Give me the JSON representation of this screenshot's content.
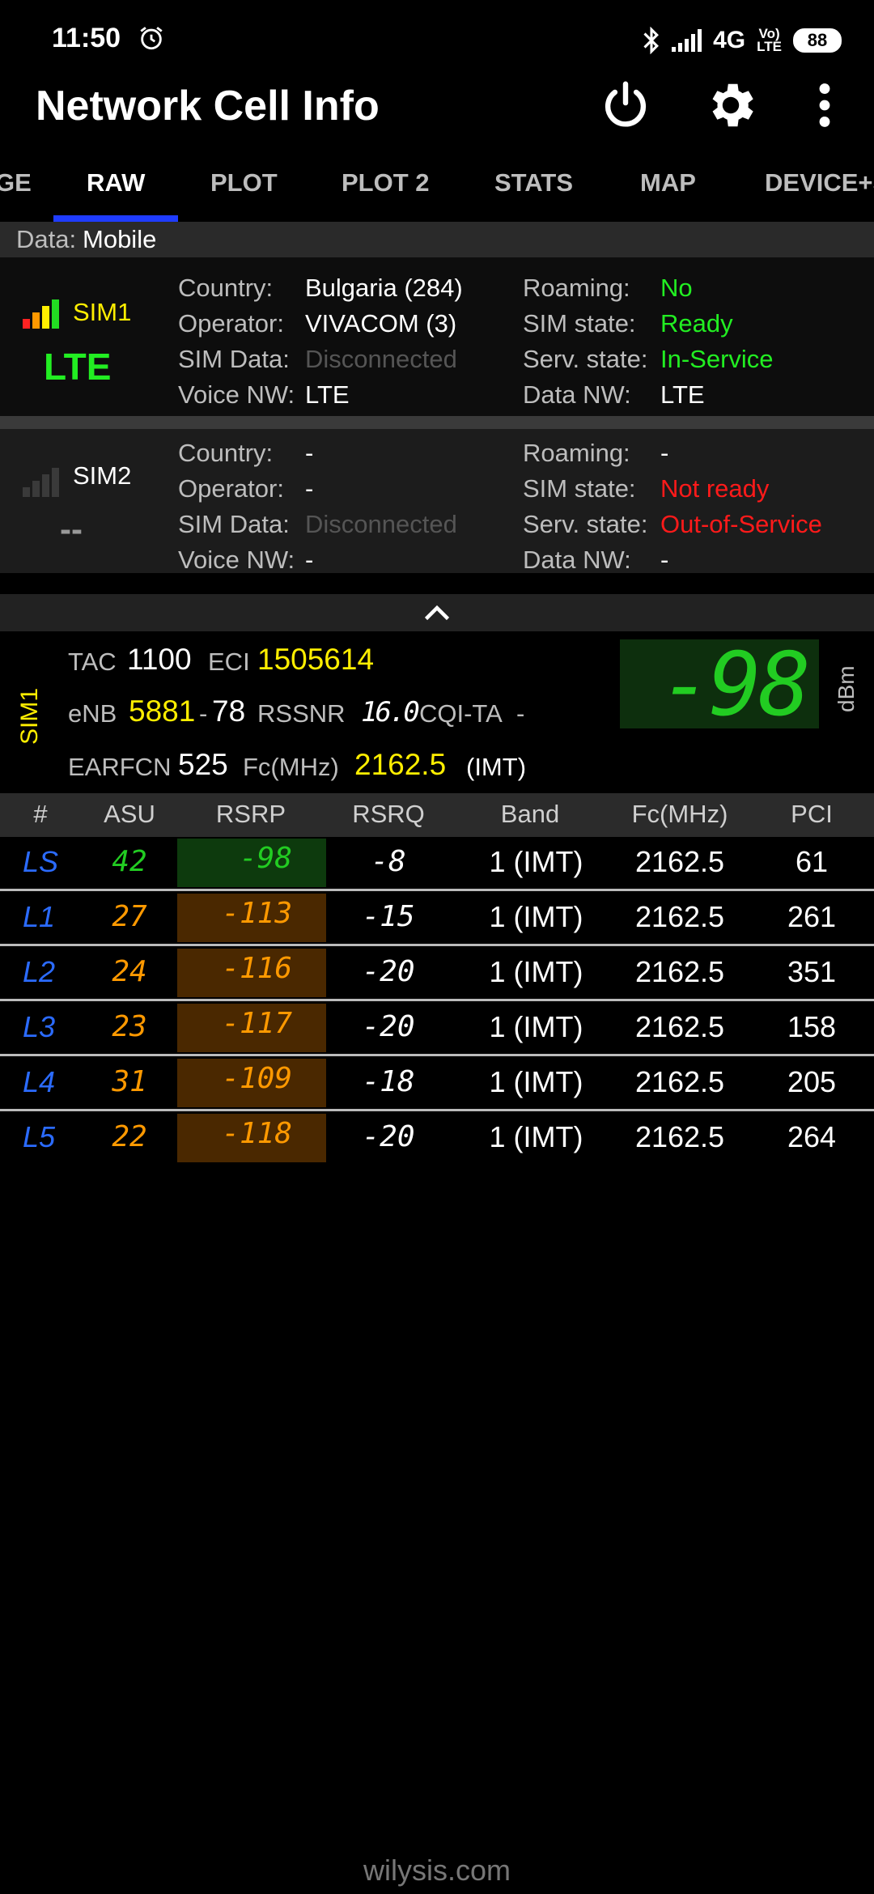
{
  "status": {
    "time": "11:50",
    "network": "4G",
    "volte_top": "Vo)",
    "volte_bottom": "LTE",
    "battery": "88"
  },
  "toolbar": {
    "title": "Network Cell Info"
  },
  "tabs": [
    "GE",
    "RAW",
    "PLOT",
    "PLOT 2",
    "STATS",
    "MAP",
    "DEVICE+S"
  ],
  "data_row": {
    "label": "Data:",
    "value": "Mobile"
  },
  "sim1": {
    "name": "SIM1",
    "tech": "LTE",
    "labels": {
      "country": "Country:",
      "operator": "Operator:",
      "sim_data": "SIM Data:",
      "voice_nw": "Voice NW:",
      "roaming": "Roaming:",
      "sim_state": "SIM state:",
      "serv_state": "Serv. state:",
      "data_nw": "Data NW:"
    },
    "country": "Bulgaria (284)",
    "operator": "VIVACOM (3)",
    "sim_data": "Disconnected",
    "voice_nw": "LTE",
    "roaming": "No",
    "sim_state": "Ready",
    "serv_state": "In-Service",
    "data_nw": "LTE"
  },
  "sim2": {
    "name": "SIM2",
    "tech": "--",
    "labels": {
      "country": "Country:",
      "operator": "Operator:",
      "sim_data": "SIM Data:",
      "voice_nw": "Voice NW:",
      "roaming": "Roaming:",
      "sim_state": "SIM state:",
      "serv_state": "Serv. state:",
      "data_nw": "Data NW:"
    },
    "country": "-",
    "operator": "-",
    "sim_data": "Disconnected",
    "voice_nw": "-",
    "roaming": "-",
    "sim_state": "Not ready",
    "serv_state": "Out-of-Service",
    "data_nw": "-"
  },
  "serving": {
    "sim_label": "SIM1",
    "tac_label": "TAC",
    "tac": "1100",
    "eci_label": "ECI",
    "eci": "1505614",
    "enb_label": "eNB",
    "enb": "5881",
    "enb_sep": "-",
    "cell": "78",
    "rssnr_label": "RSSNR",
    "rssnr": "16.0",
    "cqi_label": "CQI-TA",
    "cqi": "-",
    "earfcn_label": "EARFCN",
    "earfcn": "525",
    "fc_label": "Fc(MHz)",
    "fc": "2162.5",
    "band_name": "(IMT)",
    "rsrp_big": "-98",
    "unit": "dBm"
  },
  "table": {
    "headers": [
      "#",
      "ASU",
      "RSRP",
      "RSRQ",
      "Band",
      "Fc(MHz)",
      "PCI"
    ],
    "rows": [
      {
        "id": "LS",
        "asu": "42",
        "rsrp": "-98",
        "rsrq": "-8",
        "band": "1 (IMT)",
        "fc": "2162.5",
        "pci": "61"
      },
      {
        "id": "L1",
        "asu": "27",
        "rsrp": "-113",
        "rsrq": "-15",
        "band": "1 (IMT)",
        "fc": "2162.5",
        "pci": "261"
      },
      {
        "id": "L2",
        "asu": "24",
        "rsrp": "-116",
        "rsrq": "-20",
        "band": "1 (IMT)",
        "fc": "2162.5",
        "pci": "351"
      },
      {
        "id": "L3",
        "asu": "23",
        "rsrp": "-117",
        "rsrq": "-20",
        "band": "1 (IMT)",
        "fc": "2162.5",
        "pci": "158"
      },
      {
        "id": "L4",
        "asu": "31",
        "rsrp": "-109",
        "rsrq": "-18",
        "band": "1 (IMT)",
        "fc": "2162.5",
        "pci": "205"
      },
      {
        "id": "L5",
        "asu": "22",
        "rsrp": "-118",
        "rsrq": "-20",
        "band": "1 (IMT)",
        "fc": "2162.5",
        "pci": "264"
      }
    ]
  },
  "footer": "wilysis.com"
}
